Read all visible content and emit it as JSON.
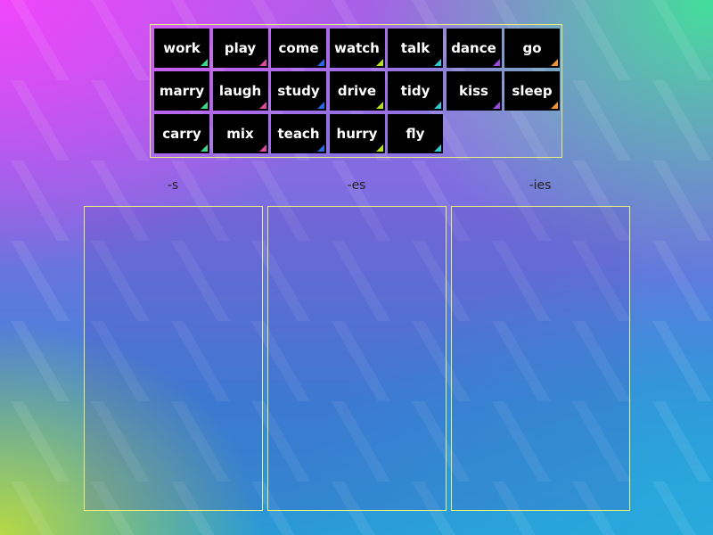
{
  "tiles": [
    {
      "word": "work",
      "color": "#3fd68a"
    },
    {
      "word": "play",
      "color": "#d94a9a"
    },
    {
      "word": "come",
      "color": "#2a6ae0"
    },
    {
      "word": "watch",
      "color": "#b4e02a"
    },
    {
      "word": "talk",
      "color": "#30c8d0"
    },
    {
      "word": "dance",
      "color": "#9a4ae0"
    },
    {
      "word": "go",
      "color": "#f0963a"
    },
    {
      "word": "marry",
      "color": "#3fd68a"
    },
    {
      "word": "laugh",
      "color": "#d94a9a"
    },
    {
      "word": "study",
      "color": "#2a6ae0"
    },
    {
      "word": "drive",
      "color": "#b4e02a"
    },
    {
      "word": "tidy",
      "color": "#30c8d0"
    },
    {
      "word": "kiss",
      "color": "#9a4ae0"
    },
    {
      "word": "sleep",
      "color": "#f0963a"
    },
    {
      "word": "carry",
      "color": "#3fd68a"
    },
    {
      "word": "mix",
      "color": "#d94a9a"
    },
    {
      "word": "teach",
      "color": "#2a6ae0"
    },
    {
      "word": "hurry",
      "color": "#b4e02a"
    },
    {
      "word": "fly",
      "color": "#30c8d0"
    }
  ],
  "groups": [
    {
      "label": "-s"
    },
    {
      "label": "-es"
    },
    {
      "label": "-ies"
    }
  ]
}
